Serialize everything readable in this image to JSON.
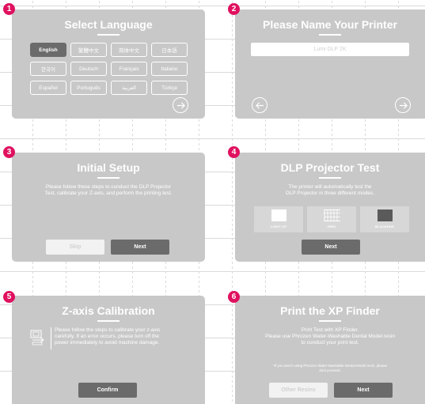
{
  "steps": [
    {
      "number": "1",
      "title": "Select Language"
    },
    {
      "number": "2",
      "title": "Please Name Your Printer"
    },
    {
      "number": "3",
      "title": "Initial Setup"
    },
    {
      "number": "4",
      "title": "DLP Projector Test"
    },
    {
      "number": "5",
      "title": "Z-axis Calibration"
    },
    {
      "number": "6",
      "title": "Print the XP Finder"
    }
  ],
  "languages": [
    "English",
    "繁體中文",
    "简体中文",
    "日本語",
    "한국어",
    "Deutsch",
    "Français",
    "Italiano",
    "Español",
    "Português",
    "العربية",
    "Türkçe"
  ],
  "selected_language": "English",
  "printer_name_placeholder": "Lumi DLP 2K",
  "initial_setup": {
    "line1": "Please follow these steps to conduct the DLP Projector",
    "line2": "Test, calibrate your Z-axis, and perform the printing test.",
    "skip_label": "Skip",
    "next_label": "Next"
  },
  "projector_test": {
    "line1": "The printer will automatically test the",
    "line2": "DLP Projector in three different modes.",
    "modes": [
      "LIGHT UP",
      "GRID",
      "BLACKEND"
    ],
    "next_label": "Next"
  },
  "z_calibration": {
    "line1": "Please follow the steps to calibrate your z-axis",
    "line2": "carefully. If an error occurs, please turn off the",
    "line3": "power immediately to avoid machine damage.",
    "confirm_label": "Confirm"
  },
  "xp_finder": {
    "line1": "Print Test with XP Finder.",
    "line2": "Please use Phrozen Water-Washable Dental Model resin",
    "line3": "to conduct your print test.",
    "note1": "*If you aren't using Phrozen Water-Washable Dental Model resin, please",
    "note2": "dont proceed.",
    "other_label": "Other Resins",
    "next_label": "Next"
  },
  "colors": {
    "panel": "#c8c8c8",
    "badge": "#e0115f",
    "dark_button": "#6b6b6b"
  }
}
